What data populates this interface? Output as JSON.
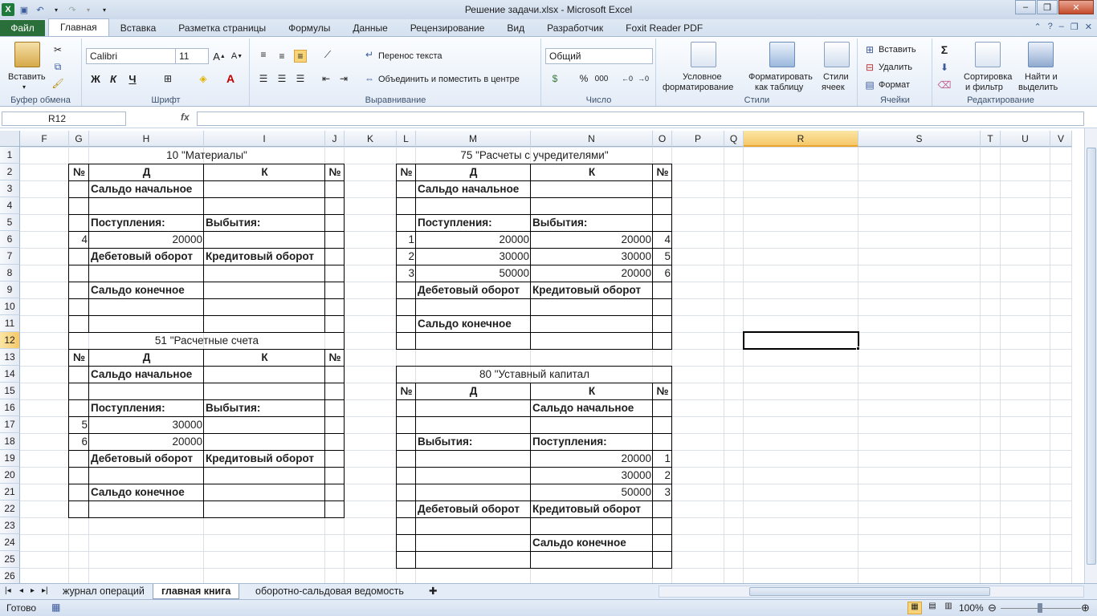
{
  "window": {
    "title": "Решение задачи.xlsx  -  Microsoft Excel"
  },
  "tabs": [
    "Файл",
    "Главная",
    "Вставка",
    "Разметка страницы",
    "Формулы",
    "Данные",
    "Рецензирование",
    "Вид",
    "Разработчик",
    "Foxit Reader PDF"
  ],
  "ribbon": {
    "clipboard": {
      "paste": "Вставить",
      "label": "Буфер обмена"
    },
    "font": {
      "name": "Calibri",
      "size": "11",
      "bold": "Ж",
      "italic": "К",
      "underline": "Ч",
      "label": "Шрифт"
    },
    "alignment": {
      "wrap": "Перенос текста",
      "merge": "Объединить и поместить в центре",
      "label": "Выравнивание"
    },
    "number": {
      "format": "Общий",
      "label": "Число",
      "percent": "%",
      "thousands": "000"
    },
    "styles": {
      "cond1": "Условное",
      "cond2": "форматирование",
      "table1": "Форматировать",
      "table2": "как таблицу",
      "cell1": "Стили",
      "cell2": "ячеек",
      "label": "Стили"
    },
    "cells": {
      "insert": "Вставить",
      "delete": "Удалить",
      "format": "Формат",
      "label": "Ячейки"
    },
    "editing": {
      "sort1": "Сортировка",
      "sort2": "и фильтр",
      "find1": "Найти и",
      "find2": "выделить",
      "label": "Редактирование"
    }
  },
  "formula_bar": {
    "name_box": "R12",
    "fx": "fx",
    "value": ""
  },
  "columns": [
    "F",
    "G",
    "H",
    "I",
    "J",
    "K",
    "L",
    "M",
    "N",
    "O",
    "P",
    "Q",
    "R",
    "S",
    "T",
    "U",
    "V"
  ],
  "rows": [
    "1",
    "2",
    "3",
    "4",
    "5",
    "6",
    "7",
    "8",
    "9",
    "10",
    "11",
    "12",
    "13",
    "14",
    "15",
    "16",
    "17",
    "18",
    "19",
    "20",
    "21",
    "22",
    "23",
    "24",
    "25",
    "26"
  ],
  "sheet": {
    "acc10": {
      "title": "10 \"Материалы\"",
      "no": "№",
      "d": "Д",
      "k": "К",
      "saldo_start": "Сальдо начальное",
      "receipts": "Поступления:",
      "disposals": "Выбытия:",
      "r6_n": "4",
      "r6_d": "20000",
      "debit_turnover": "Дебетовый оборот",
      "credit_turnover": "Кредитовый оборот",
      "saldo_end": "Сальдо конечное"
    },
    "acc51": {
      "title": "51 \"Расчетные счета",
      "no": "№",
      "d": "Д",
      "k": "К",
      "saldo_start": "Сальдо начальное",
      "receipts": "Поступления:",
      "disposals": "Выбытия:",
      "r17_n": "5",
      "r17_d": "30000",
      "r18_n": "6",
      "r18_d": "20000",
      "debit_turnover": "Дебетовый оборот",
      "credit_turnover": "Кредитовый оборот",
      "saldo_end": "Сальдо конечное"
    },
    "acc75": {
      "title": "75 \"Расчеты с учредителями\"",
      "no": "№",
      "d": "Д",
      "k": "К",
      "saldo_start": "Сальдо начальное",
      "receipts": "Поступления:",
      "disposals": "Выбытия:",
      "rows": [
        {
          "nl": "1",
          "d": "20000",
          "k": "20000",
          "nr": "4"
        },
        {
          "nl": "2",
          "d": "30000",
          "k": "30000",
          "nr": "5"
        },
        {
          "nl": "3",
          "d": "50000",
          "k": "20000",
          "nr": "6"
        }
      ],
      "debit_turnover": "Дебетовый оборот",
      "credit_turnover": "Кредитовый оборот",
      "saldo_end": "Сальдо конечное"
    },
    "acc80": {
      "title": "80 \"Уставный капитал",
      "no": "№",
      "d": "Д",
      "k": "К",
      "saldo_start": "Сальдо начальное",
      "disposals": "Выбытия:",
      "receipts": "Поступления:",
      "rows": [
        {
          "k": "20000",
          "nr": "1"
        },
        {
          "k": "30000",
          "nr": "2"
        },
        {
          "k": "50000",
          "nr": "3"
        }
      ],
      "debit_turnover": "Дебетовый оборот",
      "credit_turnover": "Кредитовый оборот",
      "saldo_end": "Сальдо конечное"
    }
  },
  "sheet_tabs": [
    "журнал операций",
    "главная книга",
    "оборотно-сальдовая ведомость"
  ],
  "status": {
    "ready": "Готово",
    "zoom": "100%"
  }
}
